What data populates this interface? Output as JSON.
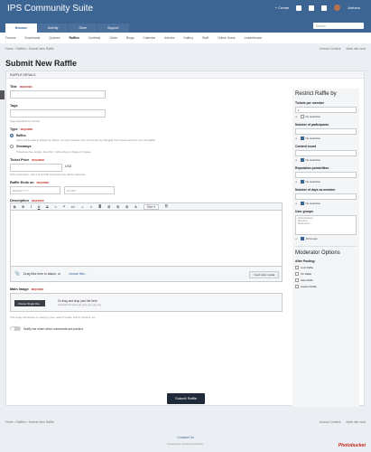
{
  "app": {
    "title": "IPS Community Suite",
    "create": "Create",
    "user": "Adriano"
  },
  "tabs": [
    "Browse",
    "Activity",
    "Store",
    "Support"
  ],
  "search": {
    "placeholder": "Search"
  },
  "subnav": [
    "Forums",
    "Downloads",
    "Quizzes",
    "Raffles",
    "Contests",
    "Clubs",
    "Blogs",
    "Calendar",
    "Articles",
    "Gallery",
    "Staff",
    "Online Users",
    "Leaderboard"
  ],
  "breadcrumb": [
    "Home",
    "Raffles",
    "Submit New Raffle"
  ],
  "bc_right": [
    "Unread Content",
    "Mark site read"
  ],
  "page_title": "Submit New Raffle",
  "section": "RAFFLE DETAILS",
  "form": {
    "title_label": "Title",
    "required": "REQUIRED",
    "tags_label": "Tags",
    "tags_hint": "Tags separated by comma.",
    "type_label": "Type",
    "opt1": "Raffles",
    "opt1_desc": "Users will be able to charge for tickets. You can monetize your community by changing Commission and Fee from this Raffle.",
    "opt2": "Giveaways",
    "opt2_desc": "Tickets are free entries. Give Win / Gift entries or charge for tickets.",
    "price_label": "Ticket Price",
    "currency": "USD",
    "price_hint": "10% commission, plus a 0.10 USD transaction fee will be deducted",
    "ends_label": "Raffle Ends on",
    "date_ph": "MM/DD/YYYY",
    "time_ph": "HH:MM",
    "desc_label": "Description",
    "size": "Size",
    "attach_text": "Drag files here to attach, or",
    "attach_link": "choose files...",
    "insert_media": "Insert other media",
    "image_label": "Main Image",
    "choose": "Choose Single File...",
    "drop": "Or drag and drop your file here",
    "accepted": "Accepted file types: gif, jpeg, jpe, jpg, png",
    "image_hint": "This image will appear on category view, search results, activity streams, etc.",
    "notify": "Notify me when other comments are posted"
  },
  "sidebar": {
    "title": "Restrict Raffle by",
    "tickets": "Tickets per member",
    "tickets_val": "1",
    "or": "or",
    "no_restriction": "No restriction",
    "participants": "Number of participants",
    "content": "Content count",
    "reputation": "Reputation points/likes",
    "days": "Number of days as member",
    "groups": "User groups",
    "group_list": [
      "Administrators",
      "Members",
      "Moderators"
    ],
    "all_groups": "All Groups",
    "mod_title": "Moderator Options",
    "after": "After Posting:",
    "mod_opts": [
      "Lock Raffle",
      "Pin Raffle",
      "Hide Raffle",
      "Feature Raffle"
    ]
  },
  "submit": "Submit Raffle",
  "footer": {
    "contact": "Contact Us",
    "powered": "Powered by Invision Community",
    "watermark": "Photobucket"
  }
}
